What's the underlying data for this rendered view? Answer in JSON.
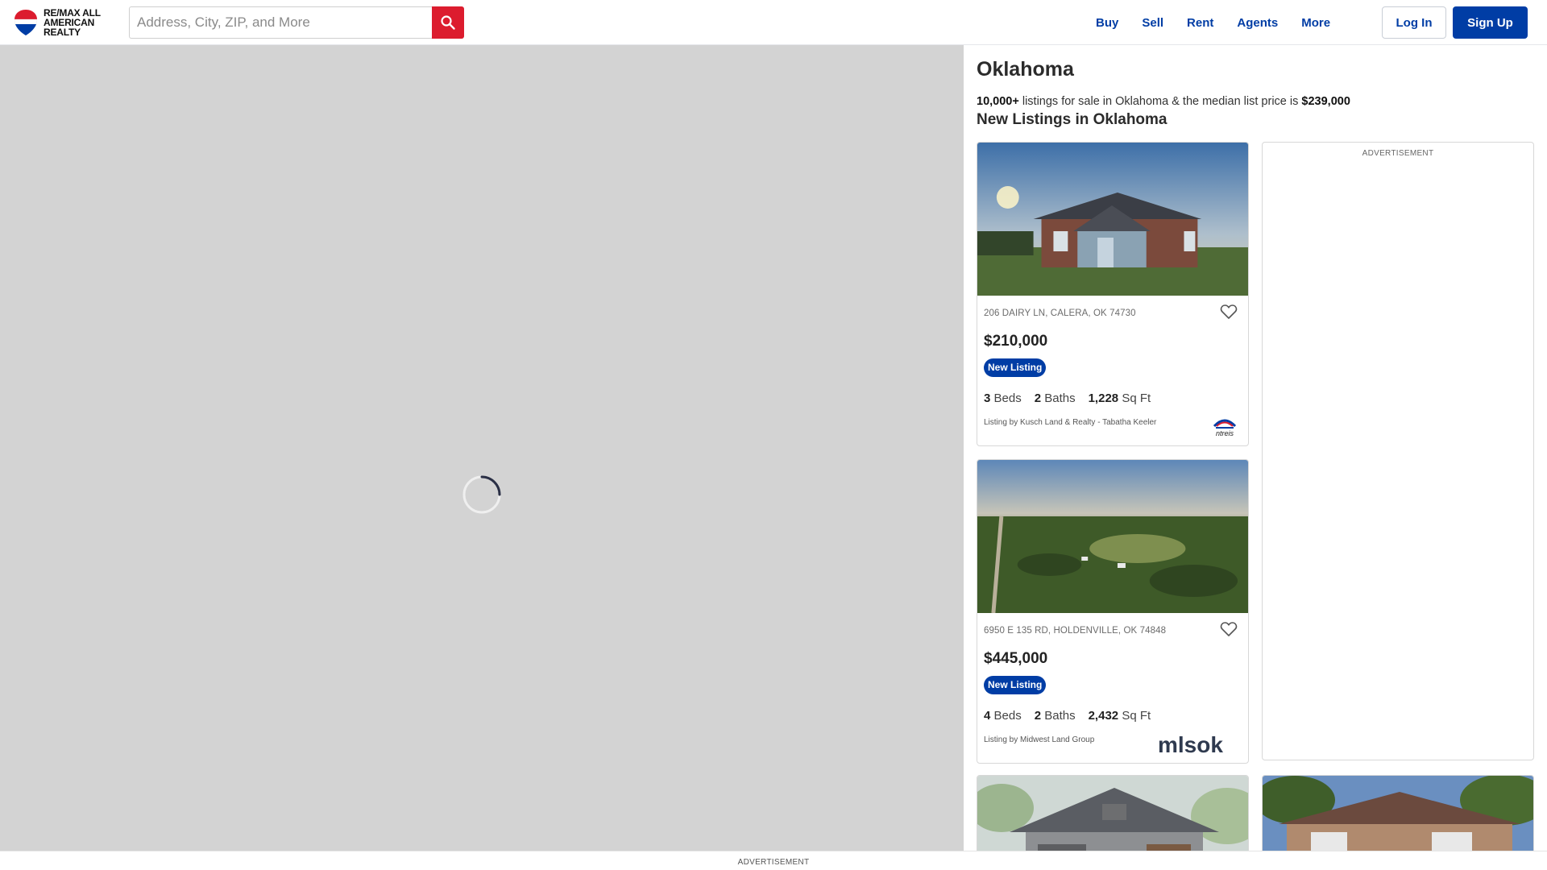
{
  "brand": {
    "logo_text_1": "RE/MAX ALL",
    "logo_text_2": "AMERICAN",
    "logo_text_3": "REALTY"
  },
  "search": {
    "placeholder": "Address, City, ZIP, and More"
  },
  "nav": {
    "items": [
      "Buy",
      "Sell",
      "Rent",
      "Agents",
      "More"
    ],
    "login": "Log In",
    "signup": "Sign Up"
  },
  "colors": {
    "primary": "#003da5",
    "search_button": "#dc1c2e",
    "map_bg": "#d3d3d3"
  },
  "panel": {
    "title": "Oklahoma",
    "summary_count": "10,000+",
    "summary_mid": "listings for sale in Oklahoma & the median list price is",
    "summary_price": "$239,000",
    "new_listings_title": "New Listings in Oklahoma"
  },
  "listings": [
    {
      "address": "206 DAIRY LN, CALERA, OK 74730",
      "price": "$210,000",
      "badge": "New Listing",
      "beds": "3",
      "beds_label": "Beds",
      "baths": "2",
      "baths_label": "Baths",
      "sqft": "1,228",
      "sqft_label": "Sq Ft",
      "listing_by": "Listing by Kusch Land & Realty - Tabatha Keeler",
      "mls_logo": "ntreis"
    },
    {
      "address": "6950 E 135 RD, HOLDENVILLE, OK 74848",
      "price": "$445,000",
      "badge": "New Listing",
      "beds": "4",
      "beds_label": "Beds",
      "baths": "2",
      "baths_label": "Baths",
      "sqft": "2,432",
      "sqft_label": "Sq Ft",
      "listing_by": "Listing by Midwest Land Group",
      "mls_logo": "mlsok"
    }
  ],
  "ads": {
    "sidebar_label": "ADVERTISEMENT",
    "bottom_label": "ADVERTISEMENT"
  }
}
